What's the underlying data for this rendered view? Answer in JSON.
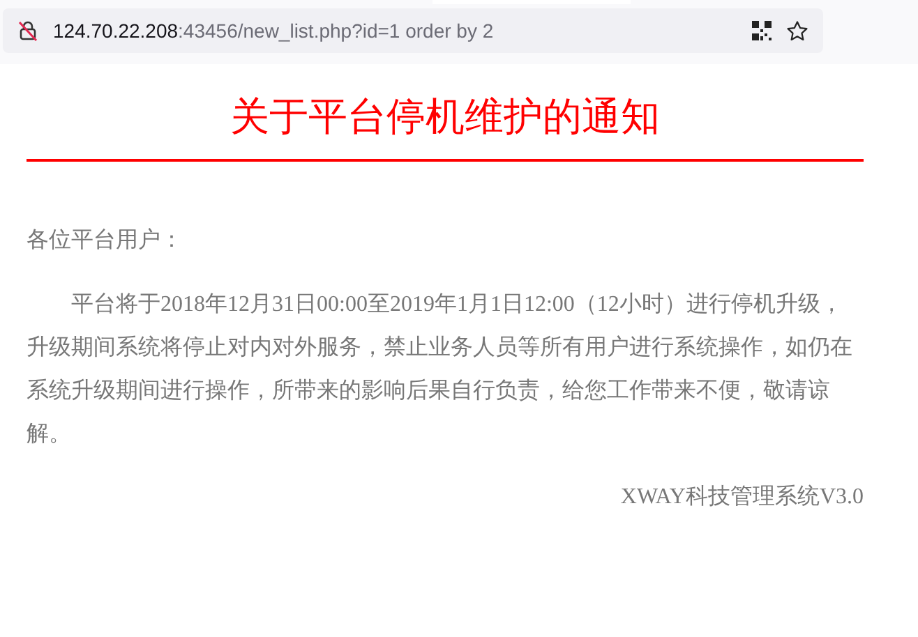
{
  "address_bar": {
    "host": "124.70.22.208",
    "path": ":43456/new_list.php?id=1 order by 2"
  },
  "notice": {
    "title": "关于平台停机维护的通知",
    "greeting": "各位平台用户：",
    "body": "平台将于2018年12月31日00:00至2019年1月1日12:00（12小时）进行停机升级，升级期间系统将停止对内对外服务，禁止业务人员等所有用户进行系统操作，如仍在系统升级期间进行操作，所带来的影响后果自行负责，给您工作带来不便，敬请谅解。",
    "signature": "XWAY科技管理系统V3.0"
  }
}
